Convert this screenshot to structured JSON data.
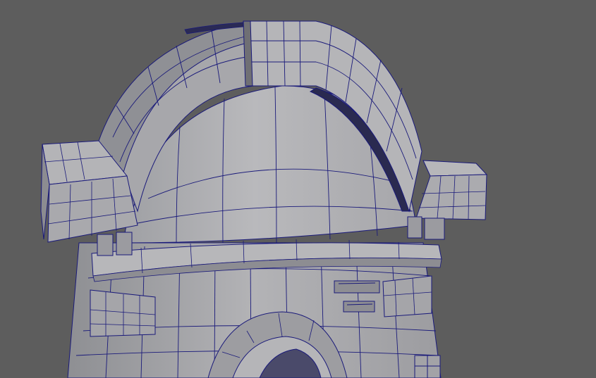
{
  "viewport": {
    "mode": "wireframe-on-shaded",
    "object": "arched-stone-archway-model",
    "colors": {
      "background": "#5d5d5d",
      "surface_light": "#b6b6b9",
      "surface_mid": "#a9a9ad",
      "surface_dark": "#8f8f94",
      "shadow": "#6f6f74",
      "wire": "#1a1a7a"
    }
  }
}
